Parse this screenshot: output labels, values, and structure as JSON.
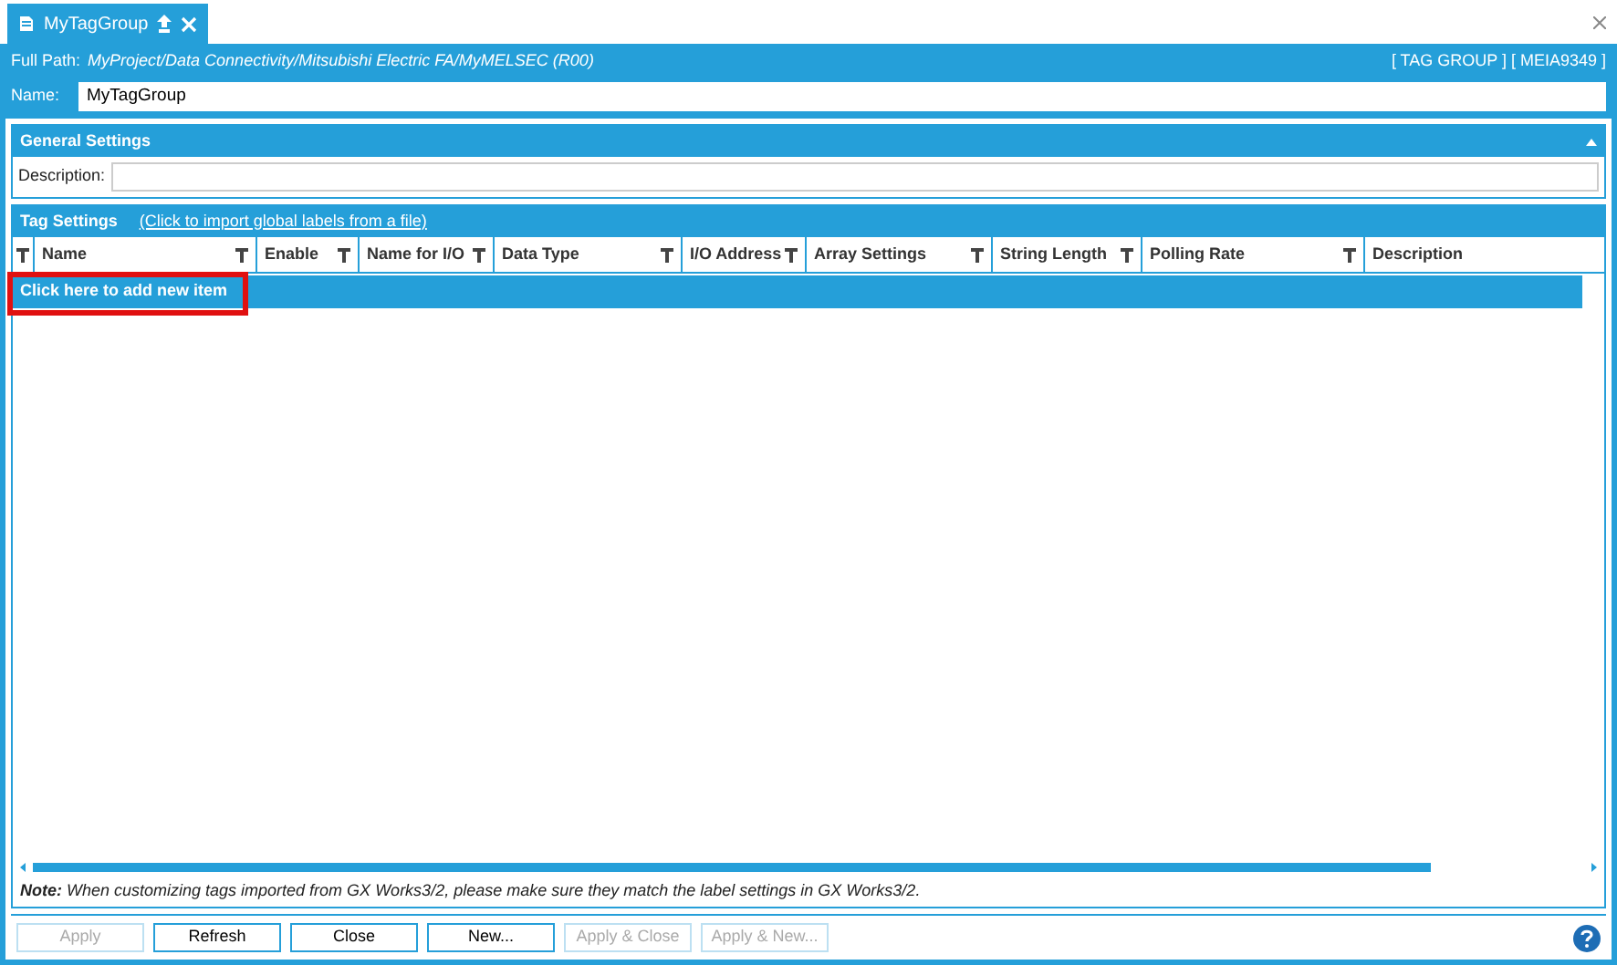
{
  "tab": {
    "title": "MyTagGroup",
    "selected": true
  },
  "header": {
    "path_label": "Full Path:",
    "path": "MyProject/Data Connectivity/Mitsubishi Electric FA/MyMELSEC (R00)",
    "info": "[ TAG GROUP ] [ MEIA9349 ]",
    "name_label": "Name:",
    "name_value": "MyTagGroup"
  },
  "general_settings": {
    "title": "General Settings",
    "expanded": true,
    "description_label": "Description:"
  },
  "tag_settings": {
    "title": "Tag Settings",
    "import_link": "(Click to import global labels from a file)",
    "columns": [
      {
        "label": "Name",
        "filter": true
      },
      {
        "label": "Enable",
        "filter": true
      },
      {
        "label": "Name for I/O",
        "filter": true
      },
      {
        "label": "Data Type",
        "filter": true
      },
      {
        "label": "I/O Address",
        "filter": true
      },
      {
        "label": "Array Settings",
        "filter": true
      },
      {
        "label": "String Length",
        "filter": true
      },
      {
        "label": "Polling Rate",
        "filter": true
      },
      {
        "label": "Description",
        "filter": false
      }
    ],
    "add_row": "Click here to add new item",
    "add_row_highlighted": true,
    "note": "**Note:** When customizing tags imported from GX Works3/2, please make sure they match the label settings in GX Works3/2."
  },
  "buttons": [
    {
      "label": "Apply",
      "disabled": true
    },
    {
      "label": "Refresh",
      "disabled": false
    },
    {
      "label": "Close",
      "disabled": false
    },
    {
      "label": "New...",
      "disabled": false
    },
    {
      "label": "Apply & Close",
      "disabled": true
    },
    {
      "label": "Apply & New...",
      "disabled": true
    }
  ]
}
